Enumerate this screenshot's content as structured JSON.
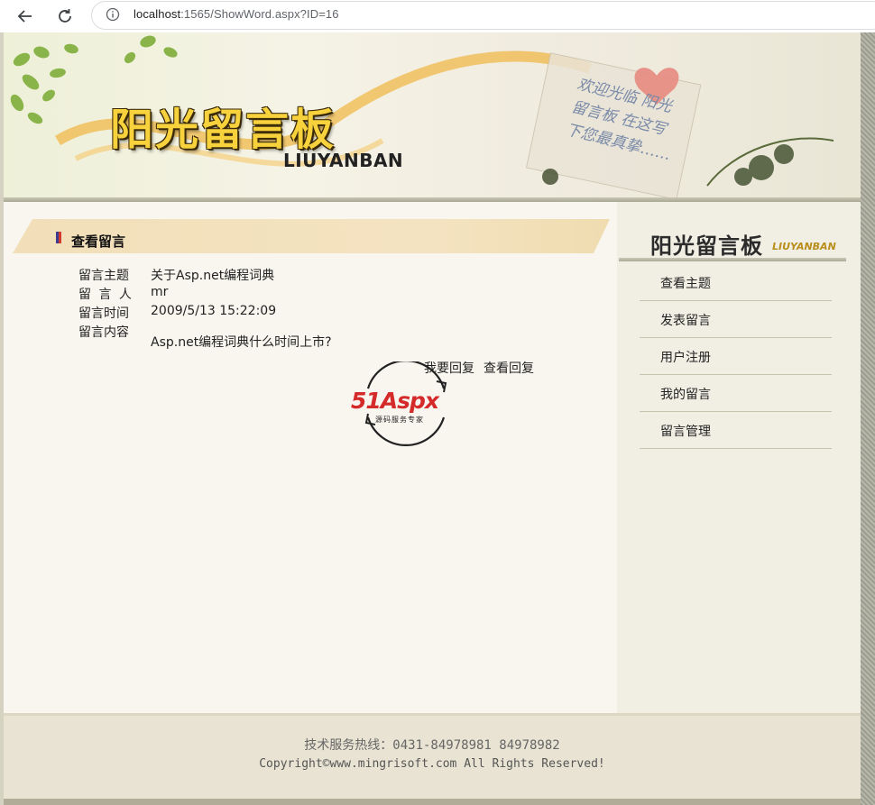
{
  "browser": {
    "url_host": "localhost",
    "url_path": ":1565/ShowWord.aspx?ID=16"
  },
  "banner": {
    "title": "阳光留言板",
    "subtitle": "LIUYANBAN",
    "note_text": "欢迎光临 阳光留言板 在这写下您最真挚……"
  },
  "main": {
    "section_title": "查看留言",
    "fields": [
      {
        "label": "留言主题",
        "value": "关于Asp.net编程词典"
      },
      {
        "label": "留 言 人",
        "value": "mr"
      },
      {
        "label": "留言时间",
        "value": "2009/5/13 15:22:09"
      },
      {
        "label": "留言内容",
        "value": "Asp.net编程词典什么时间上市?"
      }
    ],
    "reply_links": [
      "我要回复",
      "查看回复"
    ],
    "logo": {
      "text": "51Aspx",
      "tagline": "源码服务专家"
    }
  },
  "sidebar": {
    "title": "阳光留言板",
    "subtitle": "LIUYANBAN",
    "menu": [
      "查看主题",
      "发表留言",
      "用户注册",
      "我的留言",
      "留言管理"
    ]
  },
  "footer": {
    "hotline": "技术服务热线：0431-84978981   84978982",
    "copyright": "Copyright©www.mingrisoft.com All Rights Reserved!"
  },
  "colors": {
    "page_bg": "#f8f6ef",
    "section_bar": "#f2dfb9",
    "title_gold": "#f7d23c",
    "logo_red": "#d42a2a",
    "logo_green": "#2f9a33"
  }
}
